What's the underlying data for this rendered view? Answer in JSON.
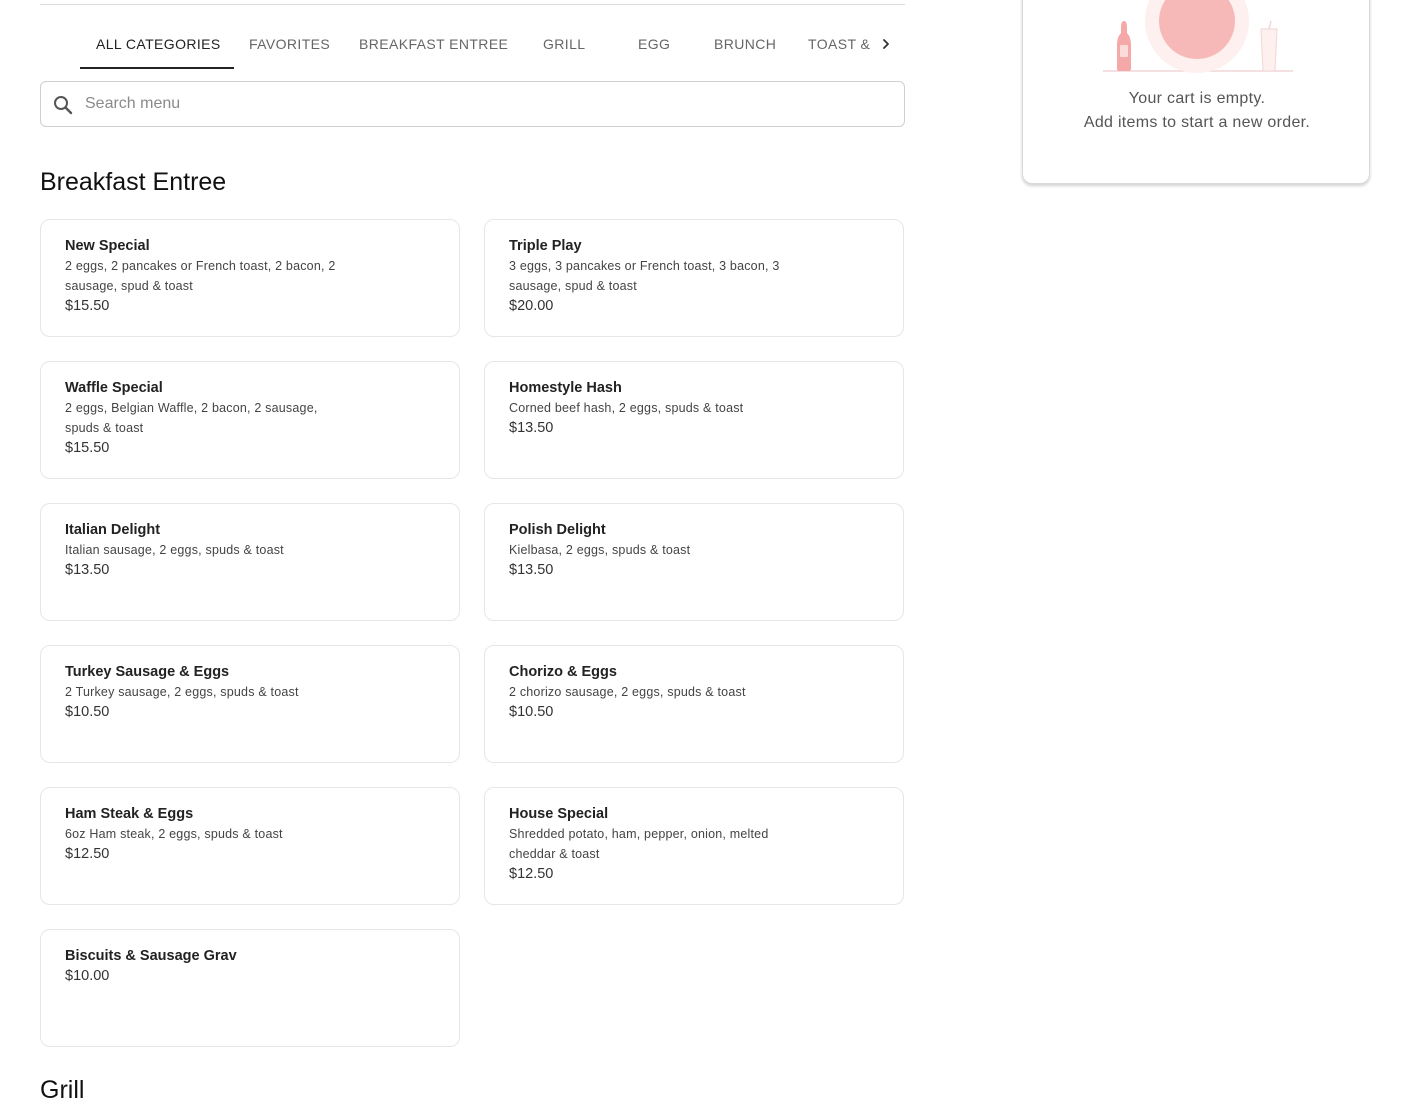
{
  "tabs": {
    "items": [
      "ALL CATEGORIES",
      "FAVORITES",
      "BREAKFAST ENTREE",
      "GRILL",
      "EGG",
      "BRUNCH"
    ],
    "clipped_item": "TOAST & ...",
    "active_index": 0,
    "next_icon": "chevron-right-icon"
  },
  "search": {
    "placeholder": "Search menu",
    "value": "",
    "icon": "search-icon"
  },
  "sections": [
    {
      "title": "Breakfast Entree",
      "items": [
        {
          "name": "New Special",
          "desc_lines": [
            "2 eggs, 2 pancakes or French toast, 2 bacon, 2",
            "sausage, spud & toast"
          ],
          "price": "$15.50"
        },
        {
          "name": "Triple Play",
          "desc_lines": [
            "3 eggs, 3 pancakes or French toast, 3 bacon, 3",
            "sausage, spud & toast"
          ],
          "price": "$20.00"
        },
        {
          "name": "Waffle Special",
          "desc_lines": [
            "2 eggs, Belgian Waffle, 2 bacon, 2 sausage,",
            "spuds & toast"
          ],
          "price": "$15.50"
        },
        {
          "name": "Homestyle Hash",
          "desc_lines": [
            "Corned beef hash, 2 eggs, spuds & toast"
          ],
          "price": "$13.50"
        },
        {
          "name": "Italian Delight",
          "desc_lines": [
            "Italian sausage, 2 eggs, spuds & toast"
          ],
          "price": "$13.50"
        },
        {
          "name": "Polish Delight",
          "desc_lines": [
            "Kielbasa, 2 eggs, spuds & toast"
          ],
          "price": "$13.50"
        },
        {
          "name": "Turkey Sausage & Eggs",
          "desc_lines": [
            "2 Turkey sausage, 2 eggs, spuds & toast"
          ],
          "price": "$10.50"
        },
        {
          "name": "Chorizo & Eggs",
          "desc_lines": [
            "2 chorizo sausage, 2 eggs, spuds & toast"
          ],
          "price": "$10.50"
        },
        {
          "name": "Ham Steak & Eggs",
          "desc_lines": [
            "6oz Ham steak, 2 eggs, spuds & toast"
          ],
          "price": "$12.50"
        },
        {
          "name": "House Special",
          "desc_lines": [
            "Shredded potato, ham, pepper, onion, melted",
            "cheddar & toast"
          ],
          "price": "$12.50"
        },
        {
          "name": "Biscuits & Sausage Grav",
          "desc_lines": [],
          "price": "$10.00"
        }
      ]
    },
    {
      "title": "Grill",
      "items": []
    }
  ],
  "cart": {
    "empty_line1": "Your cart is empty.",
    "empty_line2": "Add items to start a new order.",
    "illustration": "empty-plate-illustration"
  },
  "colors": {
    "accent_text": "#222222",
    "muted_text": "#666666",
    "border": "#e6e6e6",
    "illustration_pink": "#f4a9a8"
  }
}
